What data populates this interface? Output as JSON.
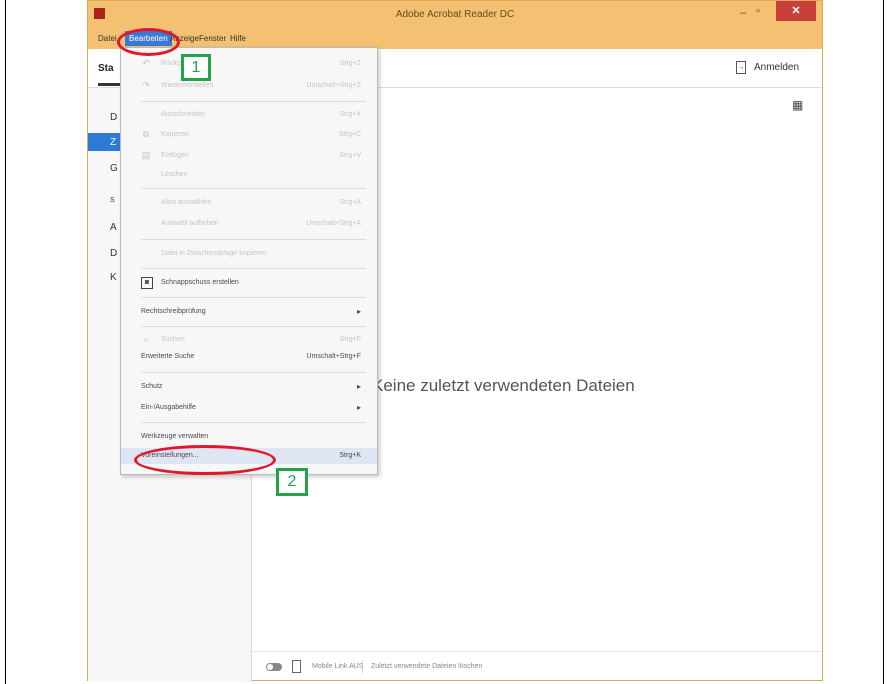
{
  "window": {
    "title": "Adobe Acrobat Reader DC",
    "minimize_glyph": "–",
    "maximize_glyph": "▫",
    "close_glyph": "✕"
  },
  "menubar": {
    "datei": "Datei",
    "bearbeiten": "Bearbeiten",
    "anzeige": "Anzeige",
    "fenster": "Fenster",
    "hilfe": "Hilfe"
  },
  "tabbar": {
    "start": "Sta",
    "login": "Anmelden"
  },
  "sidebar": {
    "items": [
      "D",
      "Z",
      "G",
      "S",
      "A",
      "D",
      "K"
    ]
  },
  "main": {
    "empty_message": "Keine zuletzt verwendeten Dateien",
    "grid_glyph": "▦"
  },
  "bottombar": {
    "mobile_link": "Mobile Link AUS",
    "clear_recent": "Zuletzt verwendete Dateien löschen"
  },
  "menu": {
    "undo": {
      "label": "Rückgängig",
      "shortcut": "Strg+Z"
    },
    "redo": {
      "label": "Wiederherstellen",
      "shortcut": "Umschalt+Strg+Z"
    },
    "cut": {
      "label": "Ausschneiden",
      "shortcut": "Strg+X"
    },
    "copy": {
      "label": "Kopieren",
      "shortcut": "Strg+C"
    },
    "paste": {
      "label": "Einfügen",
      "shortcut": "Strg+V"
    },
    "delete": {
      "label": "Löschen"
    },
    "select_all": {
      "label": "Alles auswählen",
      "shortcut": "Strg+A"
    },
    "deselect_all": {
      "label": "Auswahl aufheben",
      "shortcut": "Umschalt+Strg+A"
    },
    "copy_clipboard": {
      "label": "Datei in Zwischenablage kopieren"
    },
    "snapshot": {
      "label": "Schnappschuss erstellen"
    },
    "spellcheck": {
      "label": "Rechtschreibprüfung"
    },
    "search": {
      "label": "Suchen",
      "shortcut": "Strg+F"
    },
    "advanced_search": {
      "label": "Erweiterte Suche",
      "shortcut": "Umschalt+Strg+F"
    },
    "protection": {
      "label": "Schutz"
    },
    "accessibility": {
      "label": "Ein-/Ausgabehilfe"
    },
    "manage_tools": {
      "label": "Werkzeuge verwalten"
    },
    "preferences": {
      "label": "Voreinstellungen...",
      "shortcut": "Strg+K"
    }
  },
  "annotations": {
    "step1": "1",
    "step2": "2"
  },
  "colors": {
    "titlebar": "#f4c071",
    "menu_highlight": "#3a79d1",
    "annotation_ring": "#e0182b",
    "annotation_box": "#21a24b"
  }
}
